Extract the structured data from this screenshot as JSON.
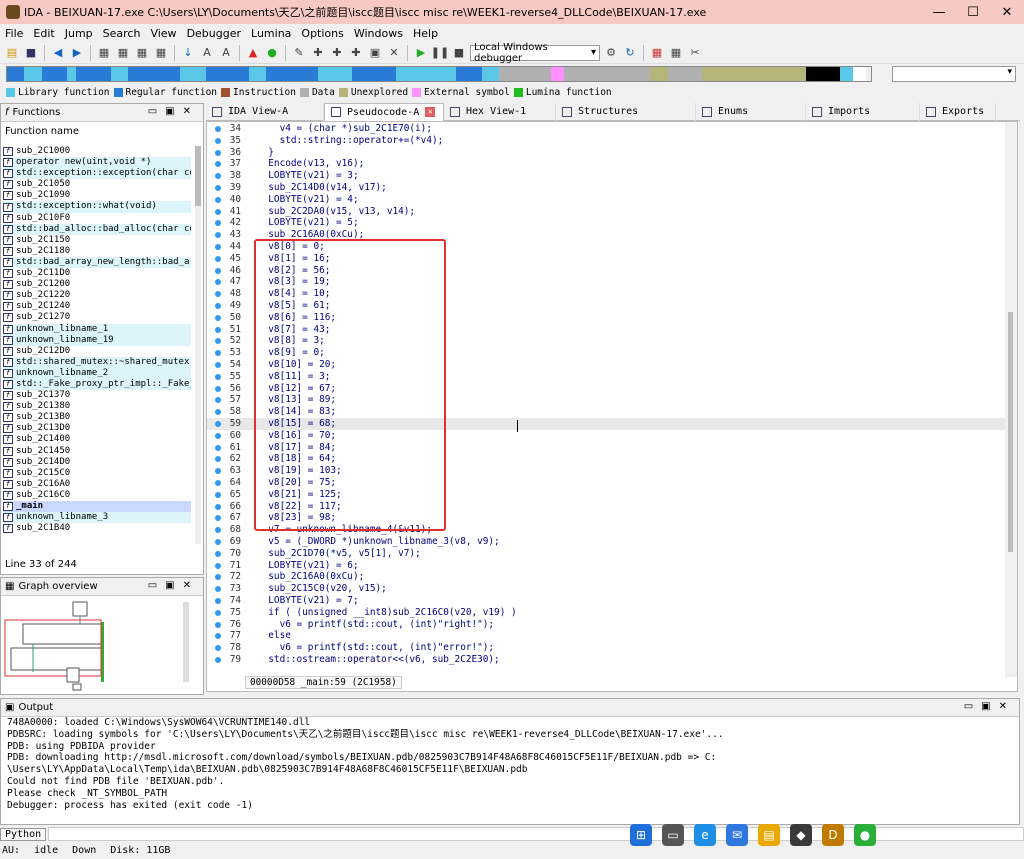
{
  "window": {
    "title": "IDA - BEIXUAN-17.exe C:\\Users\\LY\\Documents\\天乙\\之前题目\\iscc题目\\iscc misc re\\WEEK1-reverse4_DLLCode\\BEIXUAN-17.exe",
    "minimize": "—",
    "maximize": "☐",
    "close": "✕"
  },
  "menu": [
    "File",
    "Edit",
    "Jump",
    "Search",
    "View",
    "Debugger",
    "Lumina",
    "Options",
    "Windows",
    "Help"
  ],
  "toolbar": {
    "debugger_select": "Local Windows debugger"
  },
  "legend": [
    {
      "label": "Library function",
      "color": "#5bc7e9"
    },
    {
      "label": "Regular function",
      "color": "#2a7bd6"
    },
    {
      "label": "Instruction",
      "color": "#a0522d"
    },
    {
      "label": "Data",
      "color": "#b0b0b0"
    },
    {
      "label": "Unexplored",
      "color": "#b5b57a"
    },
    {
      "label": "External symbol",
      "color": "#ff90ff"
    },
    {
      "label": "Lumina function",
      "color": "#22bb22"
    }
  ],
  "functions": {
    "title": "Functions",
    "header": "Function name",
    "status": "Line 33 of 244",
    "items": [
      {
        "name": "sub_2C1000",
        "type": "regular"
      },
      {
        "name": "operator new(uint,void *)",
        "type": "library"
      },
      {
        "name": "std::exception::exception(char cons",
        "type": "library"
      },
      {
        "name": "sub_2C1050",
        "type": "regular"
      },
      {
        "name": "sub_2C1090",
        "type": "regular"
      },
      {
        "name": "std::exception::what(void)",
        "type": "library"
      },
      {
        "name": "sub_2C10F0",
        "type": "regular"
      },
      {
        "name": "std::bad_alloc::bad_alloc(char cons",
        "type": "library"
      },
      {
        "name": "sub_2C1150",
        "type": "regular"
      },
      {
        "name": "sub_2C1180",
        "type": "regular"
      },
      {
        "name": "std::bad_array_new_length::bad_arra",
        "type": "library"
      },
      {
        "name": "sub_2C11D0",
        "type": "regular"
      },
      {
        "name": "sub_2C1200",
        "type": "regular"
      },
      {
        "name": "sub_2C1220",
        "type": "regular"
      },
      {
        "name": "sub_2C1240",
        "type": "regular"
      },
      {
        "name": "sub_2C1270",
        "type": "regular"
      },
      {
        "name": "unknown_libname_1",
        "type": "library"
      },
      {
        "name": "unknown_libname_19",
        "type": "library"
      },
      {
        "name": "sub_2C12D0",
        "type": "regular"
      },
      {
        "name": "std::shared_mutex::~shared_mutex(vo",
        "type": "library"
      },
      {
        "name": "unknown_libname_2",
        "type": "library"
      },
      {
        "name": "std::_Fake_proxy_ptr_impl::_Fake_pr",
        "type": "library"
      },
      {
        "name": "sub_2C1370",
        "type": "regular"
      },
      {
        "name": "sub_2C1380",
        "type": "regular"
      },
      {
        "name": "sub_2C13B0",
        "type": "regular"
      },
      {
        "name": "sub_2C13D0",
        "type": "regular"
      },
      {
        "name": "sub_2C1400",
        "type": "regular"
      },
      {
        "name": "sub_2C1450",
        "type": "regular"
      },
      {
        "name": "sub_2C14D0",
        "type": "regular"
      },
      {
        "name": "sub_2C15C0",
        "type": "regular"
      },
      {
        "name": "sub_2C16A0",
        "type": "regular"
      },
      {
        "name": "sub_2C16C0",
        "type": "regular"
      },
      {
        "name": "_main",
        "type": "selected"
      },
      {
        "name": "unknown_libname_3",
        "type": "library"
      },
      {
        "name": "sub_2C1B40",
        "type": "regular"
      }
    ]
  },
  "graph": {
    "title": "Graph overview"
  },
  "tabs": [
    {
      "label": "IDA View-A",
      "active": false,
      "closable": false
    },
    {
      "label": "Pseudocode-A",
      "active": true,
      "closable": true
    },
    {
      "label": "Hex View-1",
      "active": false,
      "closable": false
    },
    {
      "label": "Structures",
      "active": false,
      "closable": false
    },
    {
      "label": "Enums",
      "active": false,
      "closable": false
    },
    {
      "label": "Imports",
      "active": false,
      "closable": false
    },
    {
      "label": "Exports",
      "active": false,
      "closable": false
    }
  ],
  "code": {
    "status": "00000D58 _main:59 (2C1958)",
    "lines": [
      {
        "n": "34",
        "t": "    v4 = (char *)sub_2C1E70(i);"
      },
      {
        "n": "35",
        "t": "    std::string::operator+=(*v4);"
      },
      {
        "n": "36",
        "t": "  }"
      },
      {
        "n": "37",
        "t": "  Encode(v13, v16);"
      },
      {
        "n": "38",
        "t": "  LOBYTE(v21) = 3;"
      },
      {
        "n": "39",
        "t": "  sub_2C14D0(v14, v17);"
      },
      {
        "n": "40",
        "t": "  LOBYTE(v21) = 4;"
      },
      {
        "n": "41",
        "t": "  sub_2C2DA0(v15, v13, v14);"
      },
      {
        "n": "42",
        "t": "  LOBYTE(v21) = 5;"
      },
      {
        "n": "43",
        "t": "  sub_2C16A0(0xCu);"
      },
      {
        "n": "44",
        "t": "  v8[0] = 0;"
      },
      {
        "n": "45",
        "t": "  v8[1] = 16;"
      },
      {
        "n": "46",
        "t": "  v8[2] = 56;"
      },
      {
        "n": "47",
        "t": "  v8[3] = 19;"
      },
      {
        "n": "48",
        "t": "  v8[4] = 10;"
      },
      {
        "n": "49",
        "t": "  v8[5] = 61;"
      },
      {
        "n": "50",
        "t": "  v8[6] = 116;"
      },
      {
        "n": "51",
        "t": "  v8[7] = 43;"
      },
      {
        "n": "52",
        "t": "  v8[8] = 3;"
      },
      {
        "n": "53",
        "t": "  v8[9] = 0;"
      },
      {
        "n": "54",
        "t": "  v8[10] = 20;"
      },
      {
        "n": "55",
        "t": "  v8[11] = 3;"
      },
      {
        "n": "56",
        "t": "  v8[12] = 67;"
      },
      {
        "n": "57",
        "t": "  v8[13] = 89;"
      },
      {
        "n": "58",
        "t": "  v8[14] = 83;"
      },
      {
        "n": "59",
        "t": "  v8[15] = 68;"
      },
      {
        "n": "60",
        "t": "  v8[16] = 70;"
      },
      {
        "n": "61",
        "t": "  v8[17] = 84;"
      },
      {
        "n": "62",
        "t": "  v8[18] = 64;"
      },
      {
        "n": "63",
        "t": "  v8[19] = 103;"
      },
      {
        "n": "64",
        "t": "  v8[20] = 75;"
      },
      {
        "n": "65",
        "t": "  v8[21] = 125;"
      },
      {
        "n": "66",
        "t": "  v8[22] = 117;"
      },
      {
        "n": "67",
        "t": "  v8[23] = 98;"
      },
      {
        "n": "68",
        "t": "  v7 = unknown_libname_4(&v11);"
      },
      {
        "n": "69",
        "t": "  v5 = (_DWORD *)unknown_libname_3(v8, v9);"
      },
      {
        "n": "70",
        "t": "  sub_2C1D70(*v5, v5[1], v7);"
      },
      {
        "n": "71",
        "t": "  LOBYTE(v21) = 6;"
      },
      {
        "n": "72",
        "t": "  sub_2C16A0(0xCu);"
      },
      {
        "n": "73",
        "t": "  sub_2C15C0(v20, v15);"
      },
      {
        "n": "74",
        "t": "  LOBYTE(v21) = 7;"
      },
      {
        "n": "75",
        "t": "  if ( (unsigned __int8)sub_2C16C0(v20, v19) )"
      },
      {
        "n": "76",
        "t": "    v6 = printf(std::cout, (int)\"right!\");"
      },
      {
        "n": "77",
        "t": "  else"
      },
      {
        "n": "78",
        "t": "    v6 = printf(std::cout, (int)\"error!\");"
      },
      {
        "n": "79",
        "t": "  std::ostream::operator<<(v6, sub_2C2E30);"
      }
    ]
  },
  "output": {
    "title": "Output",
    "lines": [
      "748A0000: loaded C:\\Windows\\SysWOW64\\VCRUNTIME140.dll",
      "PDBSRC: loading symbols for 'C:\\Users\\LY\\Documents\\天乙\\之前题目\\iscc题目\\iscc misc re\\WEEK1-reverse4_DLLCode\\BEIXUAN-17.exe'...",
      "PDB: using PDBIDA provider",
      "PDB: downloading http://msdl.microsoft.com/download/symbols/BEIXUAN.pdb/0825903C7B914F48A68F8C46015CF5E11F/BEIXUAN.pdb => C:",
      "\\Users\\LY\\AppData\\Local\\Temp\\ida\\BEIXUAN.pdb\\0825903C7B914F48A68F8C46015CF5E11F\\BEIXUAN.pdb",
      "Could not find PDB file 'BEIXUAN.pdb'.",
      "Please check _NT_SYMBOL_PATH",
      "Debugger: process has exited (exit code -1)"
    ]
  },
  "python_button": "Python",
  "statusbar": {
    "au": "AU:",
    "state": "idle",
    "dir": "Down",
    "disk": "Disk: 11GB"
  }
}
